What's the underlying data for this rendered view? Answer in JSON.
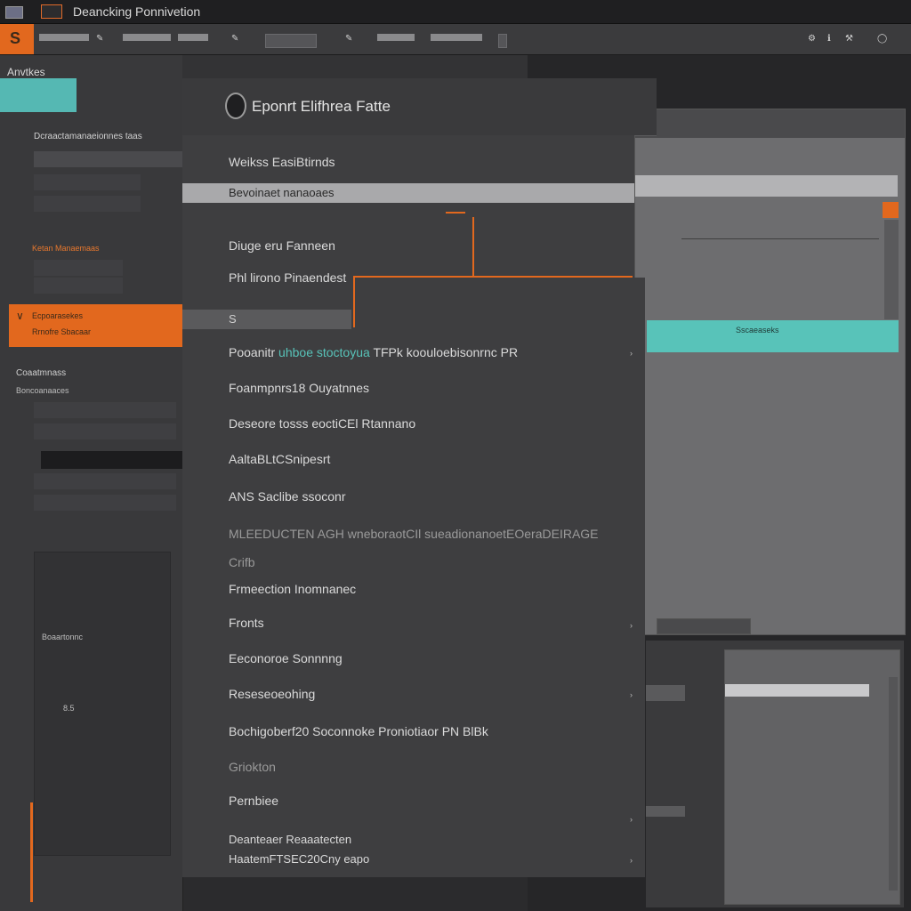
{
  "window": {
    "title": "Deancking Ponnivetion"
  },
  "toolbar": {
    "items": [
      "",
      "",
      "",
      "",
      "",
      ""
    ]
  },
  "left_panel": {
    "header": "Anvtkes",
    "section_title": "Dcraactamanaeionnes taas",
    "orange_header": "Ketan Manaemaas",
    "selected_item": {
      "line1": "Ecpoarasekes",
      "line2": "Rrnofre Sbacaar"
    },
    "lower_header": "Coaatmnass",
    "lower_sub": "Boncoanaaces",
    "sub_header": "Boaartonnc",
    "sub_num": "8.5"
  },
  "right_panel": {
    "top_label": "",
    "teal_line1": "Sscaeaseks",
    "teal_line2": "",
    "button_label": ""
  },
  "dialog": {
    "title": "Eponrt Elifhrea Fatte",
    "items": [
      "Weikss EasiBtirnds",
      "Bevoinaet nanaoaes",
      "Diuge eru Fanneen",
      "Phl lirono Pinaendest",
      "Pooanitr",
      "Foanmpnrs18 Ouyatnnes",
      "Deseore tosss eoctiCEl Rtannano",
      "AaltaBLtCSnipesrt",
      "ANS Saclibe ssoconr",
      "MLEEDUCTEN AGH wneboraotCIl sueadionanoetEOeraDEIRAGE",
      "Crifb",
      "Frmeection Inomnanec",
      "Fronts",
      "Eeconoroe Sonnnng",
      "Reseseoeohing",
      "Bochigoberf20 Soconnoke Proniotiaor PN BlBk",
      "Griokton",
      "Pernbiee",
      "Deanteaer   Reaaatecten",
      "HaatemFTSEC20Cny eapo"
    ],
    "pooanitr_teal": "uhboe stoctoyua",
    "pooanitr_rest": "TFPk koouloebisonrnc PR"
  }
}
